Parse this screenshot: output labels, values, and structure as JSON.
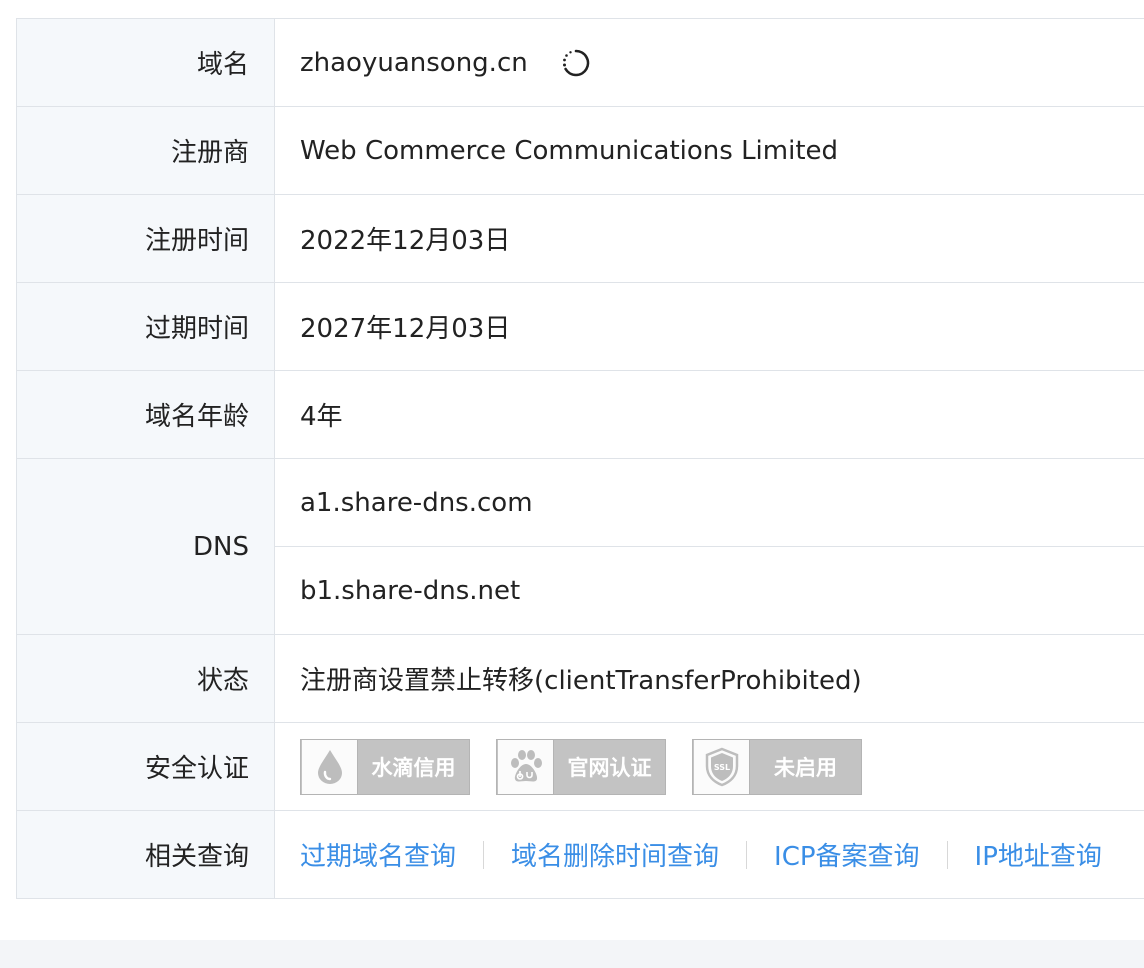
{
  "rows": {
    "domain": {
      "label": "域名",
      "value": "zhaoyuansong.cn"
    },
    "registrar": {
      "label": "注册商",
      "value": "Web Commerce Communications Limited"
    },
    "created": {
      "label": "注册时间",
      "value": "2022年12月03日"
    },
    "expires": {
      "label": "过期时间",
      "value": "2027年12月03日"
    },
    "age": {
      "label": "域名年龄",
      "value": "4年"
    },
    "dns": {
      "label": "DNS",
      "servers": [
        "a1.share-dns.com",
        "b1.share-dns.net"
      ]
    },
    "status": {
      "label": "状态",
      "value": "注册商设置禁止转移(clientTransferProhibited)"
    },
    "security": {
      "label": "安全认证",
      "badges": [
        {
          "text": "水滴信用",
          "icon": "water-drop-icon"
        },
        {
          "text": "官网认证",
          "icon": "baidu-paw-icon"
        },
        {
          "text": "未启用",
          "icon": "ssl-shield-icon"
        }
      ]
    },
    "related": {
      "label": "相关查询",
      "links": [
        "过期域名查询",
        "域名删除时间查询",
        "ICP备案查询",
        "IP地址查询"
      ]
    }
  },
  "colors": {
    "link": "#3a8ee6",
    "label_bg": "#f5f8fb",
    "border": "#dfe3e8",
    "badge_bg": "#c3c3c3"
  }
}
